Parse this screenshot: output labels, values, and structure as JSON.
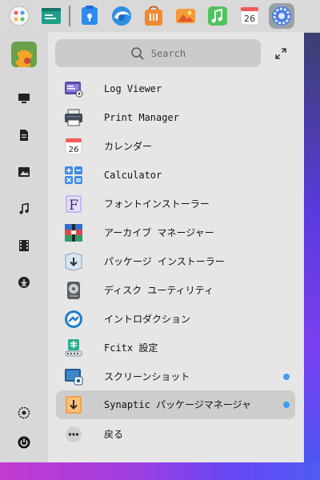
{
  "dock": {
    "items": [
      {
        "icon": "launcher-icon"
      },
      {
        "icon": "terminal-icon"
      },
      {
        "icon": "file-manager-icon"
      },
      {
        "icon": "browser-icon"
      },
      {
        "icon": "app-store-icon"
      },
      {
        "icon": "image-viewer-icon"
      },
      {
        "icon": "music-icon"
      },
      {
        "icon": "calendar-icon",
        "day": "26"
      },
      {
        "icon": "settings-icon"
      }
    ]
  },
  "search": {
    "placeholder": "Search"
  },
  "apps": [
    {
      "label": "Log Viewer",
      "icon": "log-viewer-icon",
      "new": false
    },
    {
      "label": "Print Manager",
      "icon": "printer-icon",
      "new": false
    },
    {
      "label": "カレンダー",
      "icon": "calendar-icon",
      "day": "26",
      "new": false
    },
    {
      "label": "Calculator",
      "icon": "calculator-icon",
      "new": false
    },
    {
      "label": "フォントインストーラー",
      "icon": "font-installer-icon",
      "glyph": "F",
      "new": false
    },
    {
      "label": "アーカイブ マネージャー",
      "icon": "archive-manager-icon",
      "new": false
    },
    {
      "label": "パッケージ インストーラー",
      "icon": "package-installer-icon",
      "new": false
    },
    {
      "label": "ディスク ユーティリティ",
      "icon": "disk-utility-icon",
      "new": false
    },
    {
      "label": "イントロダクション",
      "icon": "introduction-icon",
      "new": false
    },
    {
      "label": "Fcitx 設定",
      "icon": "fcitx-settings-icon",
      "new": false
    },
    {
      "label": "スクリーンショット",
      "icon": "screenshot-icon",
      "new": true
    },
    {
      "label": "Synaptic パッケージマネージャ",
      "icon": "synaptic-icon",
      "new": true
    },
    {
      "label": "戻る",
      "icon": "back-icon",
      "new": false
    }
  ],
  "sidebar": {
    "items": [
      {
        "icon": "computer-icon"
      },
      {
        "icon": "document-icon"
      },
      {
        "icon": "picture-icon"
      },
      {
        "icon": "music-icon"
      },
      {
        "icon": "video-icon"
      },
      {
        "icon": "download-icon"
      }
    ],
    "bottom": [
      {
        "icon": "settings-icon"
      },
      {
        "icon": "power-icon"
      }
    ]
  },
  "colors": {
    "new_dot": "#3d9df2",
    "highlight": "#cdcdcd",
    "panel": "#e6e6e6",
    "sidebar": "#d8d8d8"
  }
}
